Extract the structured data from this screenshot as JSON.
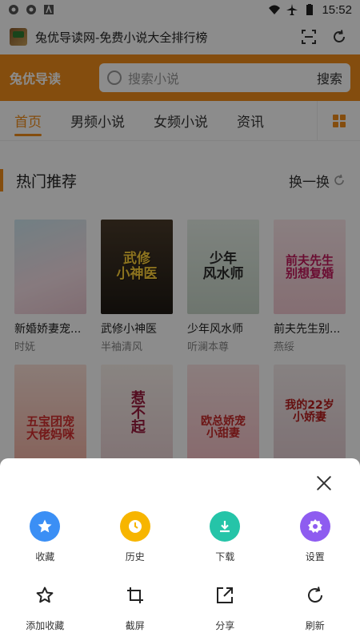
{
  "status": {
    "time": "15:52"
  },
  "browser": {
    "title": "兔优导读网-免费小说大全排行榜"
  },
  "site": {
    "logo": "兔优导读",
    "search_placeholder": "搜索小说",
    "search_button": "搜索",
    "accent": "#f08c1a"
  },
  "nav": {
    "tabs": [
      "首页",
      "男频小说",
      "女频小说",
      "资讯"
    ]
  },
  "section": {
    "title": "热门推荐",
    "more": "换一换"
  },
  "books": [
    {
      "title": "新婚娇妻宠...",
      "author": "时妩",
      "cover_text": ""
    },
    {
      "title": "武修小神医",
      "author": "半袖清风",
      "cover_text": "武修\n小神医"
    },
    {
      "title": "少年风水师",
      "author": "听澜本尊",
      "cover_text": "少年\n风水师"
    },
    {
      "title": "前夫先生别...",
      "author": "燕绥",
      "cover_text": "前夫先生\n别想复婚"
    },
    {
      "title": "",
      "author": "",
      "cover_text": "五宝团宠\n大佬妈咪"
    },
    {
      "title": "",
      "author": "",
      "cover_text": "惹不起"
    },
    {
      "title": "",
      "author": "",
      "cover_text": "欧总娇宠\n小甜妻"
    },
    {
      "title": "",
      "author": "",
      "cover_text": "我的22岁\n小娇妻"
    }
  ],
  "sheet": {
    "primary": [
      {
        "label": "收藏",
        "icon": "star-icon",
        "color": "#3b8ff5"
      },
      {
        "label": "历史",
        "icon": "clock-icon",
        "color": "#f7b500"
      },
      {
        "label": "下载",
        "icon": "download-icon",
        "color": "#25c4a8"
      },
      {
        "label": "设置",
        "icon": "gear-icon",
        "color": "#8e5cf0"
      }
    ],
    "secondary": [
      {
        "label": "添加收藏",
        "icon": "star-outline-icon"
      },
      {
        "label": "截屏",
        "icon": "crop-icon"
      },
      {
        "label": "分享",
        "icon": "share-icon"
      },
      {
        "label": "刷新",
        "icon": "refresh-icon"
      }
    ]
  }
}
